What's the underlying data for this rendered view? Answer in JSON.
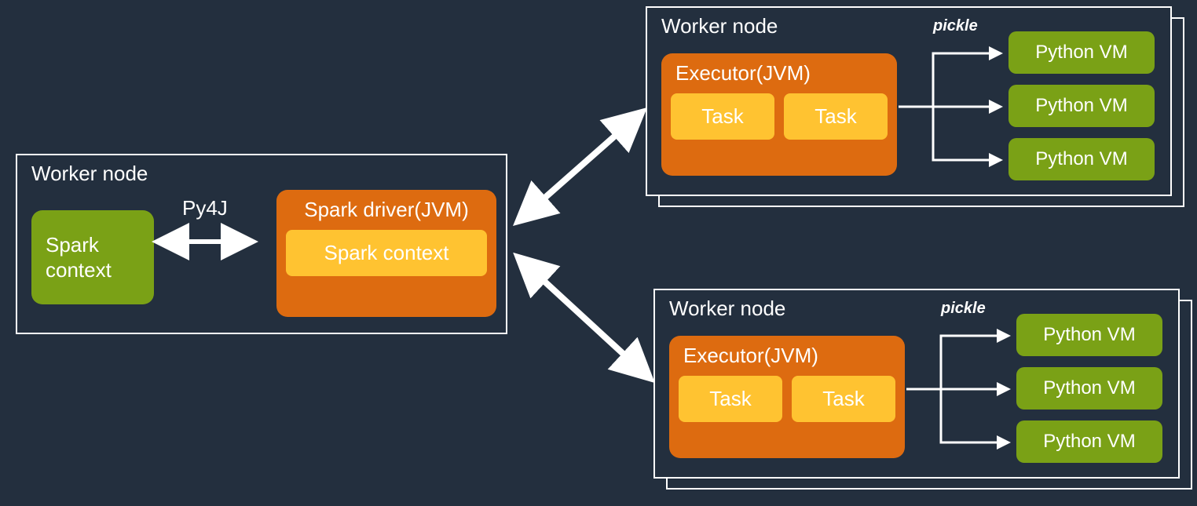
{
  "driver": {
    "worker_node_label": "Worker node",
    "spark_context_left": "Spark context",
    "py4j_label": "Py4J",
    "spark_driver_label": "Spark driver(JVM)",
    "spark_context_inner": "Spark context"
  },
  "workers": [
    {
      "worker_node_label": "Worker node",
      "executor_label": "Executor(JVM)",
      "tasks": [
        "Task",
        "Task"
      ],
      "pickle_label": "pickle",
      "python_vms": [
        "Python VM",
        "Python VM",
        "Python VM"
      ]
    },
    {
      "worker_node_label": "Worker node",
      "executor_label": "Executor(JVM)",
      "tasks": [
        "Task",
        "Task"
      ],
      "pickle_label": "pickle",
      "python_vms": [
        "Python VM",
        "Python VM",
        "Python VM"
      ]
    }
  ],
  "colors": {
    "background": "#232f3e",
    "green": "#7aa116",
    "orange": "#dd6b10",
    "yellow": "#ffc331",
    "white": "#ffffff"
  }
}
